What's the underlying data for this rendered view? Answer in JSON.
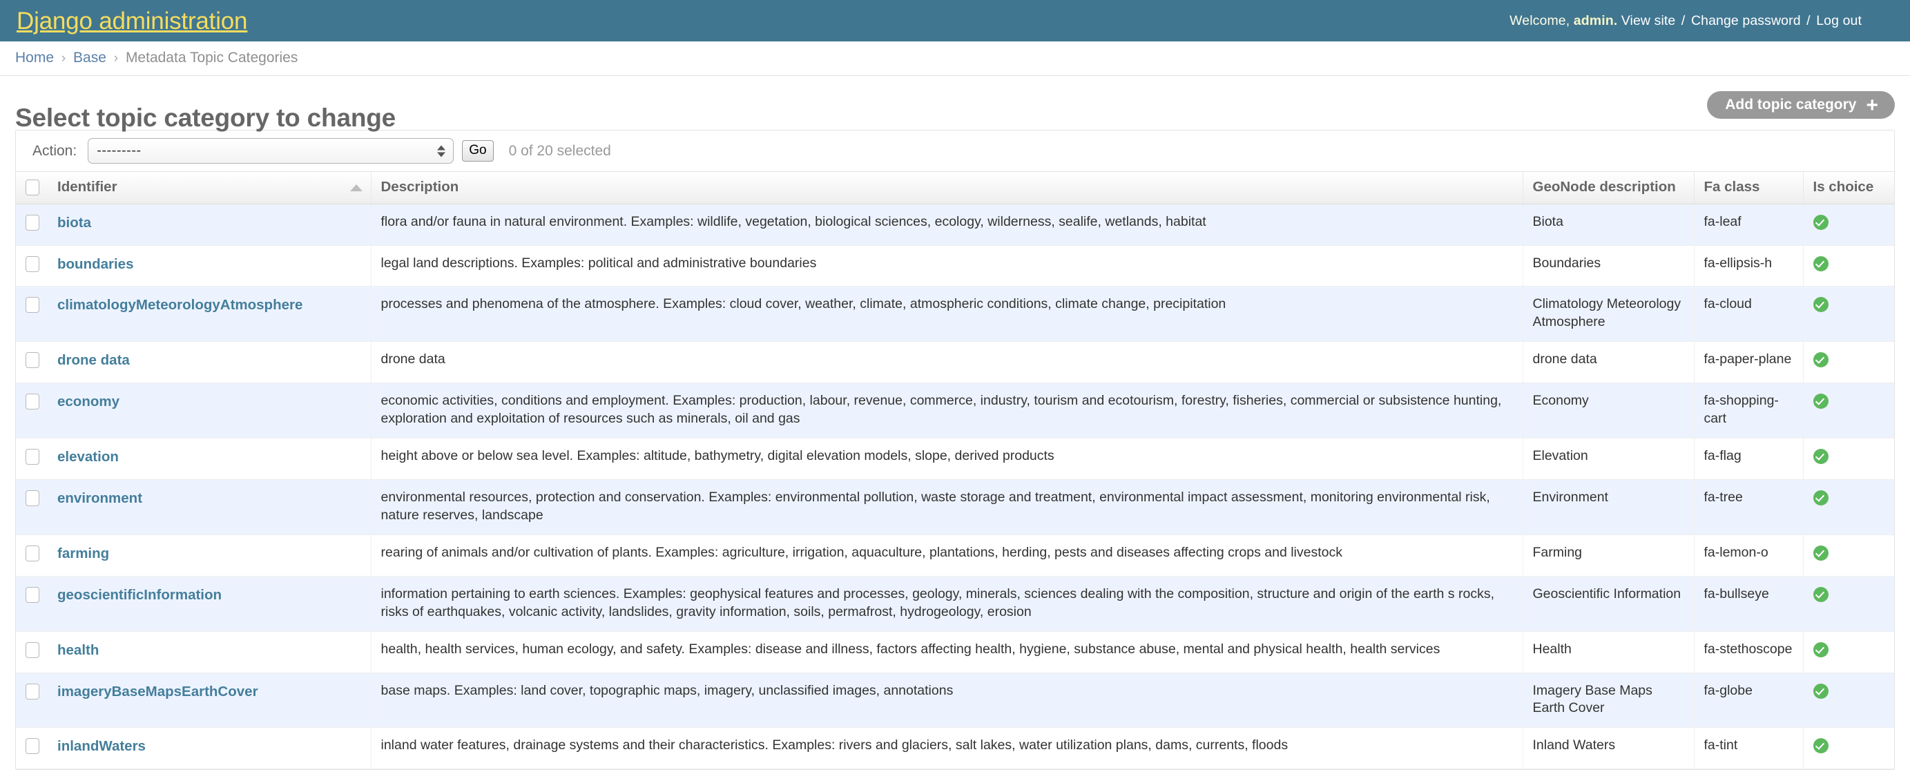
{
  "branding": {
    "site_name": "Django administration",
    "welcome_prefix": "Welcome,",
    "username": "admin.",
    "view_site": "View site",
    "change_password": "Change password",
    "log_out": "Log out",
    "separator": "/",
    "bar_color": "#417690",
    "site_name_color": "#f5dd5d"
  },
  "breadcrumbs": {
    "home": "Home",
    "app": "Base",
    "current": "Metadata Topic Categories",
    "separator": "›"
  },
  "page": {
    "title": "Select topic category to change",
    "add_button_label": "Add topic category",
    "add_button_icon": "plus-icon",
    "add_button_color": "#999999"
  },
  "actions": {
    "label": "Action:",
    "selected_option": "---------",
    "options": [
      "---------"
    ],
    "go_label": "Go",
    "counter": "0 of 20 selected"
  },
  "table": {
    "columns": [
      {
        "key": "check",
        "label": "",
        "icon": "select-all-checkbox"
      },
      {
        "key": "ident",
        "label": "Identifier",
        "sorted": "asc"
      },
      {
        "key": "desc",
        "label": "Description"
      },
      {
        "key": "geo",
        "label": "GeoNode description"
      },
      {
        "key": "fa",
        "label": "Fa class"
      },
      {
        "key": "is",
        "label": "Is choice"
      }
    ],
    "rows": [
      {
        "identifier": "biota",
        "description": "flora and/or fauna in natural environment. Examples: wildlife, vegetation, biological sciences, ecology, wilderness, sealife, wetlands, habitat",
        "geonode_description": "Biota",
        "fa_class": "fa-leaf",
        "is_choice": true
      },
      {
        "identifier": "boundaries",
        "description": "legal land descriptions. Examples: political and administrative boundaries",
        "geonode_description": "Boundaries",
        "fa_class": "fa-ellipsis-h",
        "is_choice": true
      },
      {
        "identifier": "climatologyMeteorologyAtmosphere",
        "description": "processes and phenomena of the atmosphere. Examples: cloud cover, weather, climate, atmospheric conditions, climate change, precipitation",
        "geonode_description": "Climatology Meteorology Atmosphere",
        "fa_class": "fa-cloud",
        "is_choice": true
      },
      {
        "identifier": "drone data",
        "description": "drone data",
        "geonode_description": "drone data",
        "fa_class": "fa-paper-plane",
        "is_choice": true
      },
      {
        "identifier": "economy",
        "description": "economic activities, conditions and employment. Examples: production, labour, revenue, commerce, industry, tourism and ecotourism, forestry, fisheries, commercial or subsistence hunting, exploration and exploitation of resources such as minerals, oil and gas",
        "geonode_description": "Economy",
        "fa_class": "fa-shopping-cart",
        "is_choice": true
      },
      {
        "identifier": "elevation",
        "description": "height above or below sea level. Examples: altitude, bathymetry, digital elevation models, slope, derived products",
        "geonode_description": "Elevation",
        "fa_class": "fa-flag",
        "is_choice": true
      },
      {
        "identifier": "environment",
        "description": "environmental resources, protection and conservation. Examples: environmental pollution, waste storage and treatment, environmental impact assessment, monitoring environmental risk, nature reserves, landscape",
        "geonode_description": "Environment",
        "fa_class": "fa-tree",
        "is_choice": true
      },
      {
        "identifier": "farming",
        "description": "rearing of animals and/or cultivation of plants. Examples: agriculture, irrigation, aquaculture, plantations, herding, pests and diseases affecting crops and livestock",
        "geonode_description": "Farming",
        "fa_class": "fa-lemon-o",
        "is_choice": true
      },
      {
        "identifier": "geoscientificInformation",
        "description": "information pertaining to earth sciences. Examples: geophysical features and processes, geology, minerals, sciences dealing with the composition, structure and origin of the earth s rocks, risks of earthquakes, volcanic activity, landslides, gravity information, soils, permafrost, hydrogeology, erosion",
        "geonode_description": "Geoscientific Information",
        "fa_class": "fa-bullseye",
        "is_choice": true
      },
      {
        "identifier": "health",
        "description": "health, health services, human ecology, and safety. Examples: disease and illness, factors affecting health, hygiene, substance abuse, mental and physical health, health services",
        "geonode_description": "Health",
        "fa_class": "fa-stethoscope",
        "is_choice": true
      },
      {
        "identifier": "imageryBaseMapsEarthCover",
        "description": "base maps. Examples: land cover, topographic maps, imagery, unclassified images, annotations",
        "geonode_description": "Imagery Base Maps Earth Cover",
        "fa_class": "fa-globe",
        "is_choice": true
      },
      {
        "identifier": "inlandWaters",
        "description": "inland water features, drainage systems and their characteristics. Examples: rivers and glaciers, salt lakes, water utilization plans, dams, currents, floods",
        "geonode_description": "Inland Waters",
        "fa_class": "fa-tint",
        "is_choice": true
      }
    ]
  },
  "colors": {
    "link": "#447e9b",
    "row_alt": "#edf3fe",
    "yes_green": "#5cb85c",
    "heading_gray": "#666666"
  }
}
